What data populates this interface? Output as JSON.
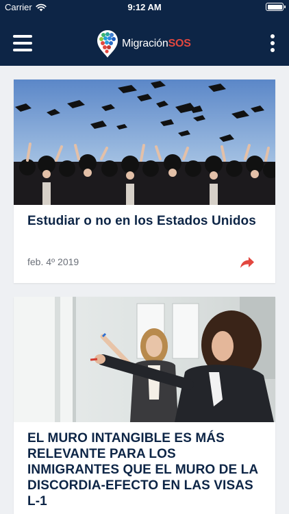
{
  "status_bar": {
    "carrier": "Carrier",
    "time": "9:12 AM"
  },
  "header": {
    "brand_plain": "Migración",
    "brand_accent": "SOS",
    "colors": {
      "bar": "#0d2546",
      "accent": "#e2473f"
    }
  },
  "articles": [
    {
      "title": "Estudiar o no en los Estados Unidos",
      "date": "feb. 4º 2019",
      "image": "graduation-caps-photo"
    },
    {
      "title": "EL MURO INTANGIBLE ES MÁS RELEVANTE PARA LOS INMIGRANTES QUE EL MURO DE LA DISCORDIA-EFECTO EN LAS VISAS L-1",
      "image": "office-whiteboard-photo"
    }
  ]
}
